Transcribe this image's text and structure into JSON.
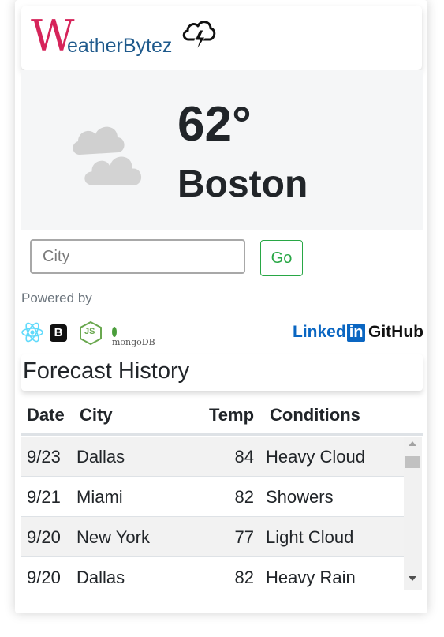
{
  "header": {
    "logo_w": "W",
    "logo_text": "eatherBytez",
    "logo_icon": "storm-cloud-icon"
  },
  "current": {
    "temperature": "62°",
    "city": "Boston",
    "condition_icon": "cloudy-icon"
  },
  "search": {
    "placeholder": "City",
    "value": "",
    "button_label": "Go"
  },
  "footer": {
    "powered_by": "Powered by",
    "tech_icons": [
      "react-icon",
      "bootstrap-icon",
      "nodejs-icon",
      "mongodb-icon"
    ],
    "mongodb_label": "mongoDB",
    "bootstrap_label": "B",
    "nodejs_label": "JS",
    "linkedin_prefix": "Linked",
    "linkedin_suffix": "in",
    "github_label": "GitHub"
  },
  "history": {
    "title": "Forecast History",
    "columns": [
      "Date",
      "City",
      "Temp",
      "Conditions"
    ],
    "rows": [
      {
        "date": "9/23",
        "city": "Dallas",
        "temp": "84",
        "conditions": "Heavy Cloud"
      },
      {
        "date": "9/21",
        "city": "Miami",
        "temp": "82",
        "conditions": "Showers"
      },
      {
        "date": "9/20",
        "city": "New York",
        "temp": "77",
        "conditions": "Light Cloud"
      },
      {
        "date": "9/20",
        "city": "Dallas",
        "temp": "82",
        "conditions": "Heavy Rain"
      }
    ]
  },
  "colors": {
    "logo_w": "#d6245a",
    "logo_text": "#1f5a8c",
    "go_button": "#28a745",
    "linkedin": "#0a66c2"
  }
}
